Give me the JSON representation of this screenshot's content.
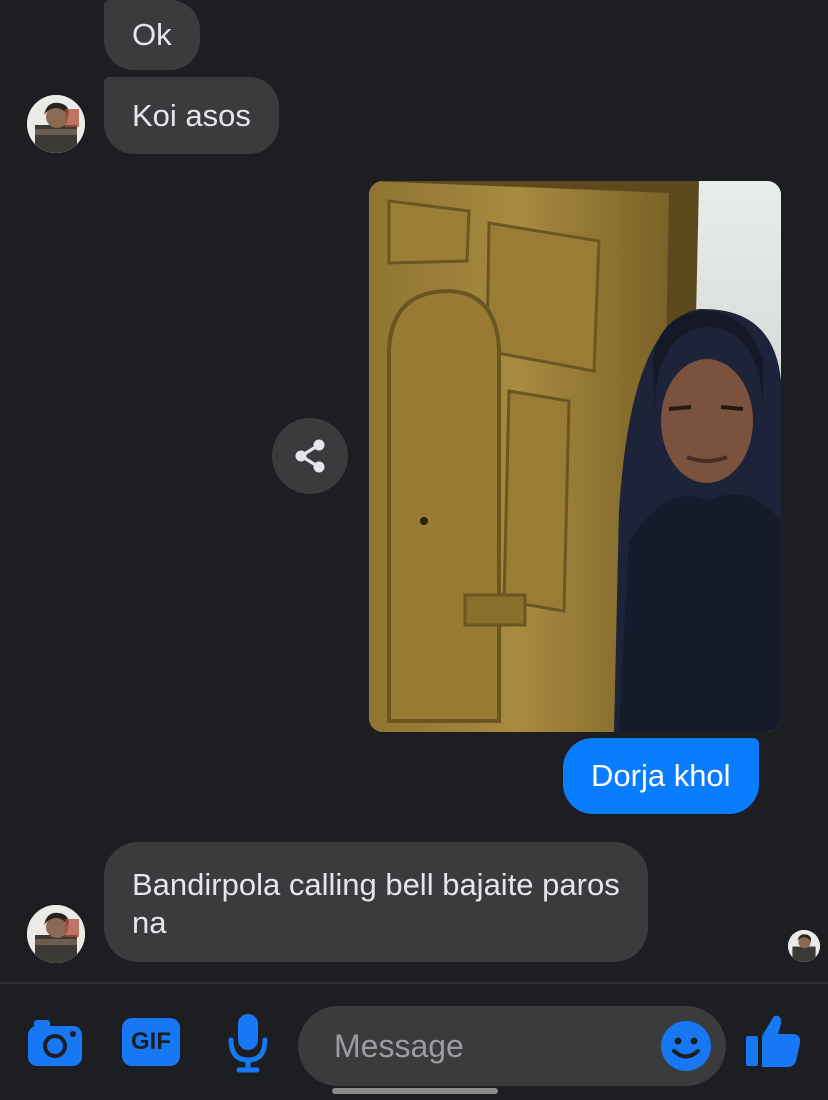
{
  "colors": {
    "background": "#1c1e21",
    "incoming_bubble": "#3a3b3c",
    "outgoing_bubble": "#0a7cff",
    "accent": "#1877f2"
  },
  "messages": [
    {
      "direction": "incoming",
      "text": "Ok"
    },
    {
      "direction": "incoming",
      "text": "Koi asos"
    },
    {
      "direction": "outgoing",
      "type": "photo",
      "content": "selfie-in-front-of-wooden-door"
    },
    {
      "direction": "outgoing",
      "text": "Dorja khol"
    },
    {
      "direction": "incoming",
      "text": "Bandirpola calling bell bajaite paros na"
    }
  ],
  "icons": {
    "share": "share-icon",
    "camera": "camera-icon",
    "gif": "GIF",
    "mic": "microphone-icon",
    "emoji": "emoji-icon",
    "like": "thumbs-up-icon"
  },
  "composer": {
    "placeholder": "Message"
  }
}
